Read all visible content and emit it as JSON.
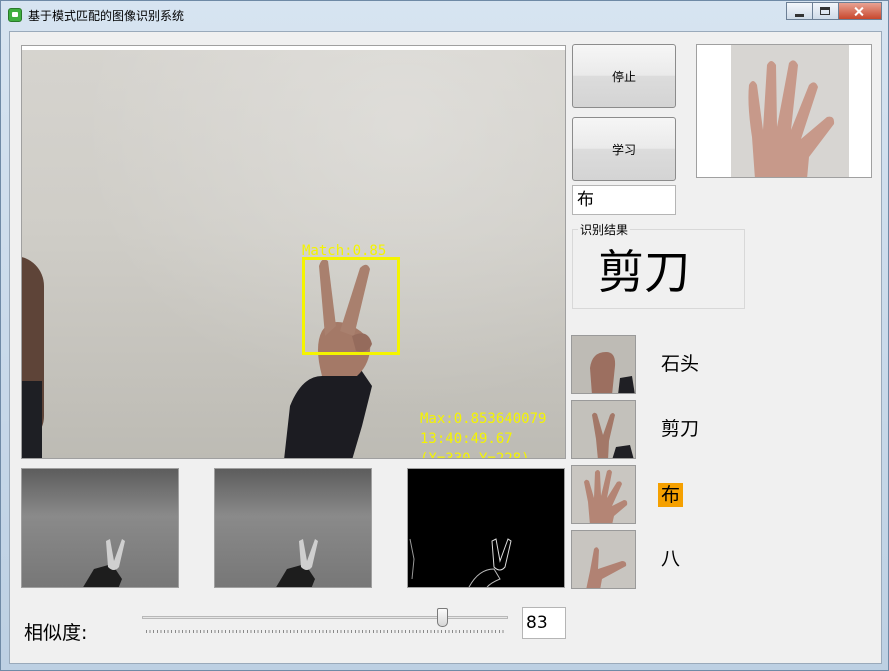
{
  "window": {
    "title": "基于模式匹配的图像识别系统",
    "icon": "app-icon"
  },
  "camera": {
    "match_text": "Match:0.85",
    "max_text": "Max:0.853640079",
    "time_text": "13:40:49.67",
    "coord_text": "(X=330,Y=228)",
    "overlay_color": "#f4f400"
  },
  "controls": {
    "stop_label": "停止",
    "learn_label": "学习",
    "name_field_value": "布"
  },
  "result": {
    "group_label": "识别结果",
    "value": "剪刀"
  },
  "templates": [
    {
      "label": "石头",
      "icon": "fist-icon",
      "highlighted": false
    },
    {
      "label": "剪刀",
      "icon": "victory-hand-icon",
      "highlighted": false
    },
    {
      "label": "布",
      "icon": "open-hand-icon",
      "highlighted": true
    },
    {
      "label": "八",
      "icon": "eight-hand-icon",
      "highlighted": false
    }
  ],
  "similarity": {
    "label": "相似度:",
    "value": "83",
    "level": 0.83
  },
  "colors": {
    "highlight": "#f5a000",
    "background": "#f0f0f0"
  }
}
